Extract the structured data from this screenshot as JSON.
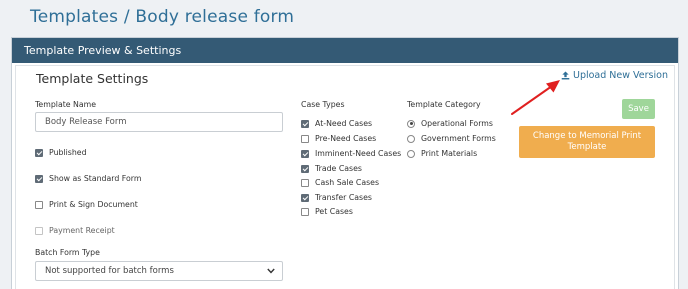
{
  "breadcrumb": {
    "root": "Templates",
    "separator": "/",
    "current": "Body release form"
  },
  "panel": {
    "title": "Template Preview & Settings"
  },
  "settings": {
    "title": "Template Settings"
  },
  "upload": {
    "label": "Upload New Version",
    "icon": "upload-icon"
  },
  "template_name": {
    "label": "Template Name",
    "value": "Body Release Form"
  },
  "options": [
    {
      "label": "Published",
      "checked": true,
      "disabled": false
    },
    {
      "label": "Show as Standard Form",
      "checked": true,
      "disabled": false
    },
    {
      "label": "Print & Sign Document",
      "checked": false,
      "disabled": false
    },
    {
      "label": "Payment Receipt",
      "checked": false,
      "disabled": true
    }
  ],
  "batch": {
    "label": "Batch Form Type",
    "selected": "Not supported for batch forms"
  },
  "case_types": {
    "label": "Case Types",
    "items": [
      {
        "label": "At-Need Cases",
        "checked": true
      },
      {
        "label": "Pre-Need Cases",
        "checked": false
      },
      {
        "label": "Imminent-Need Cases",
        "checked": true
      },
      {
        "label": "Trade Cases",
        "checked": true
      },
      {
        "label": "Cash Sale Cases",
        "checked": false
      },
      {
        "label": "Transfer Cases",
        "checked": true
      },
      {
        "label": "Pet Cases",
        "checked": false
      }
    ]
  },
  "category": {
    "label": "Template Category",
    "items": [
      {
        "label": "Operational Forms",
        "selected": true
      },
      {
        "label": "Government Forms",
        "selected": false
      },
      {
        "label": "Print Materials",
        "selected": false
      }
    ]
  },
  "buttons": {
    "save": "Save",
    "memorial_line1": "Change to Memorial Print",
    "memorial_line2": "Template"
  },
  "colors": {
    "header": "#345a75",
    "link": "#2f6f97",
    "save": "#9fd69a",
    "memorial": "#f0ad4e",
    "annotation_arrow": "#e02020"
  }
}
